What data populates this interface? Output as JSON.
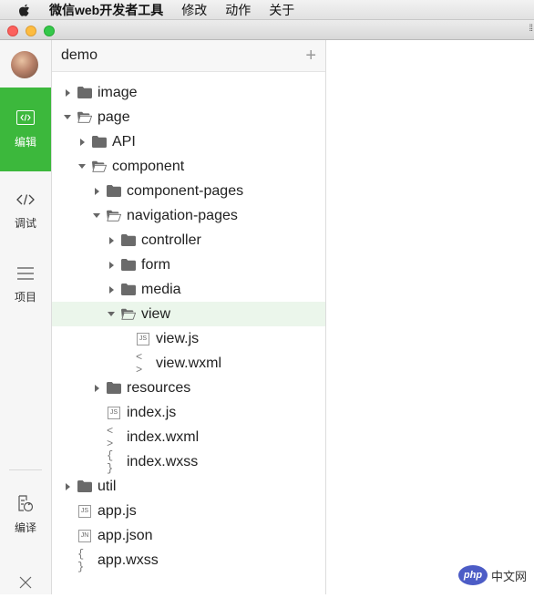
{
  "menubar": {
    "app_name": "微信web开发者工具",
    "items": [
      "修改",
      "动作",
      "关于"
    ]
  },
  "toolbar": {
    "edit_label": "编辑",
    "debug_label": "调试",
    "project_label": "项目",
    "compile_label": "编译",
    "active_color": "#3cb83c"
  },
  "panel": {
    "project_name": "demo",
    "add_symbol": "+"
  },
  "tree": [
    {
      "label": "image",
      "type": "folder",
      "expanded": false,
      "depth": 0
    },
    {
      "label": "page",
      "type": "folder",
      "expanded": true,
      "depth": 0
    },
    {
      "label": "API",
      "type": "folder",
      "expanded": false,
      "depth": 1
    },
    {
      "label": "component",
      "type": "folder",
      "expanded": true,
      "depth": 1
    },
    {
      "label": "component-pages",
      "type": "folder",
      "expanded": false,
      "depth": 2
    },
    {
      "label": "navigation-pages",
      "type": "folder",
      "expanded": true,
      "depth": 2
    },
    {
      "label": "controller",
      "type": "folder",
      "expanded": false,
      "depth": 3
    },
    {
      "label": "form",
      "type": "folder",
      "expanded": false,
      "depth": 3
    },
    {
      "label": "media",
      "type": "folder",
      "expanded": false,
      "depth": 3
    },
    {
      "label": "view",
      "type": "folder",
      "expanded": true,
      "depth": 3,
      "selected": true
    },
    {
      "label": "view.js",
      "type": "js",
      "depth": 4
    },
    {
      "label": "view.wxml",
      "type": "wxml",
      "depth": 4
    },
    {
      "label": "resources",
      "type": "folder",
      "expanded": false,
      "depth": 2
    },
    {
      "label": "index.js",
      "type": "js",
      "depth": 2
    },
    {
      "label": "index.wxml",
      "type": "wxml",
      "depth": 2
    },
    {
      "label": "index.wxss",
      "type": "wxss",
      "depth": 2
    },
    {
      "label": "util",
      "type": "folder",
      "expanded": false,
      "depth": 0
    },
    {
      "label": "app.js",
      "type": "js",
      "depth": 0
    },
    {
      "label": "app.json",
      "type": "json",
      "depth": 0
    },
    {
      "label": "app.wxss",
      "type": "wxss",
      "depth": 0
    }
  ],
  "file_badges": {
    "js": "JS",
    "json": "JN",
    "wxml": "< >",
    "wxss": "{ }"
  },
  "watermark": {
    "logo": "php",
    "text": "中文网"
  }
}
